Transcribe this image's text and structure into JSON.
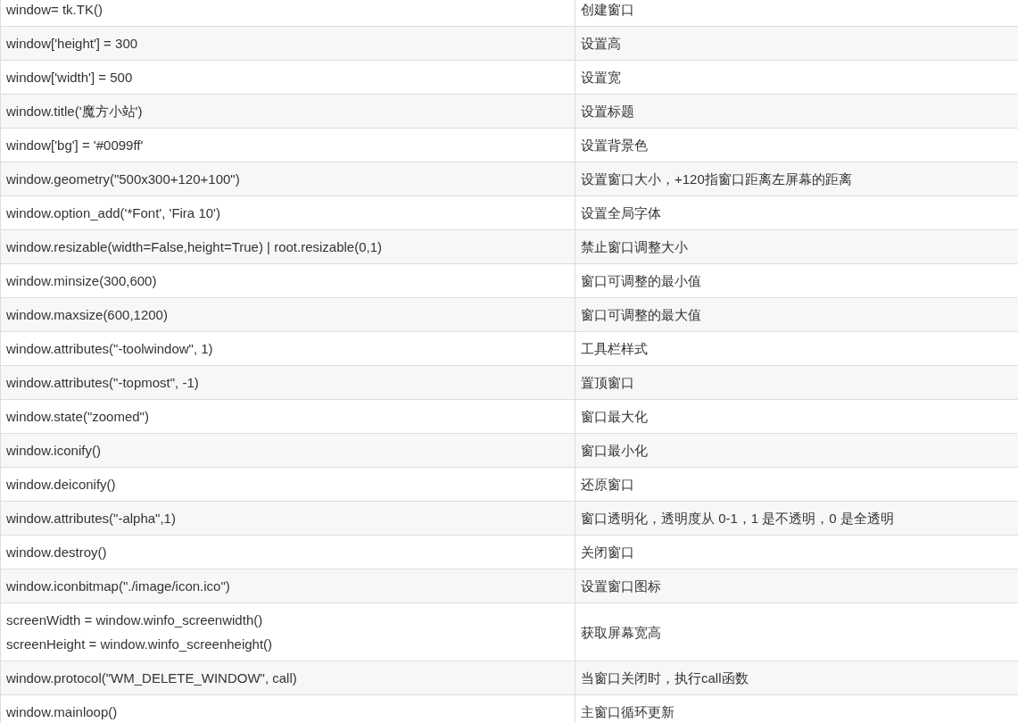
{
  "table": {
    "rows": [
      {
        "code": [
          "window= tk.TK()"
        ],
        "description": "创建窗口"
      },
      {
        "code": [
          "window['height'] = 300"
        ],
        "description": "设置高"
      },
      {
        "code": [
          "window['width'] = 500"
        ],
        "description": "设置宽"
      },
      {
        "code": [
          "window.title('魔方小站')"
        ],
        "description": "设置标题"
      },
      {
        "code": [
          "window['bg'] = '#0099ff'"
        ],
        "description": "设置背景色"
      },
      {
        "code": [
          "window.geometry(\"500x300+120+100\")"
        ],
        "description": "设置窗口大小，+120指窗口距离左屏幕的距离"
      },
      {
        "code": [
          "window.option_add('*Font', 'Fira 10')"
        ],
        "description": "设置全局字体"
      },
      {
        "code": [
          "window.resizable(width=False,height=True) | root.resizable(0,1)"
        ],
        "description": "禁止窗口调整大小"
      },
      {
        "code": [
          "window.minsize(300,600)"
        ],
        "description": "窗口可调整的最小值"
      },
      {
        "code": [
          "window.maxsize(600,1200)"
        ],
        "description": "窗口可调整的最大值"
      },
      {
        "code": [
          "window.attributes(\"-toolwindow\", 1)"
        ],
        "description": "工具栏样式"
      },
      {
        "code": [
          "window.attributes(\"-topmost\", -1)"
        ],
        "description": "置顶窗口"
      },
      {
        "code": [
          "window.state(\"zoomed\")"
        ],
        "description": "窗口最大化"
      },
      {
        "code": [
          "window.iconify()"
        ],
        "description": "窗口最小化"
      },
      {
        "code": [
          "window.deiconify()"
        ],
        "description": "还原窗口"
      },
      {
        "code": [
          "window.attributes(\"-alpha\",1)"
        ],
        "description": "窗口透明化，透明度从 0-1，1 是不透明，0 是全透明"
      },
      {
        "code": [
          "window.destroy()"
        ],
        "description": "关闭窗口"
      },
      {
        "code": [
          "window.iconbitmap(\"./image/icon.ico\")"
        ],
        "description": "设置窗口图标"
      },
      {
        "code": [
          "screenWidth = window.winfo_screenwidth()",
          "screenHeight = window.winfo_screenheight()"
        ],
        "description": "获取屏幕宽高"
      },
      {
        "code": [
          "window.protocol(\"WM_DELETE_WINDOW\", call)"
        ],
        "description": "当窗口关闭时，执行call函数"
      },
      {
        "code": [
          "window.mainloop()"
        ],
        "description": "主窗口循环更新"
      }
    ]
  }
}
